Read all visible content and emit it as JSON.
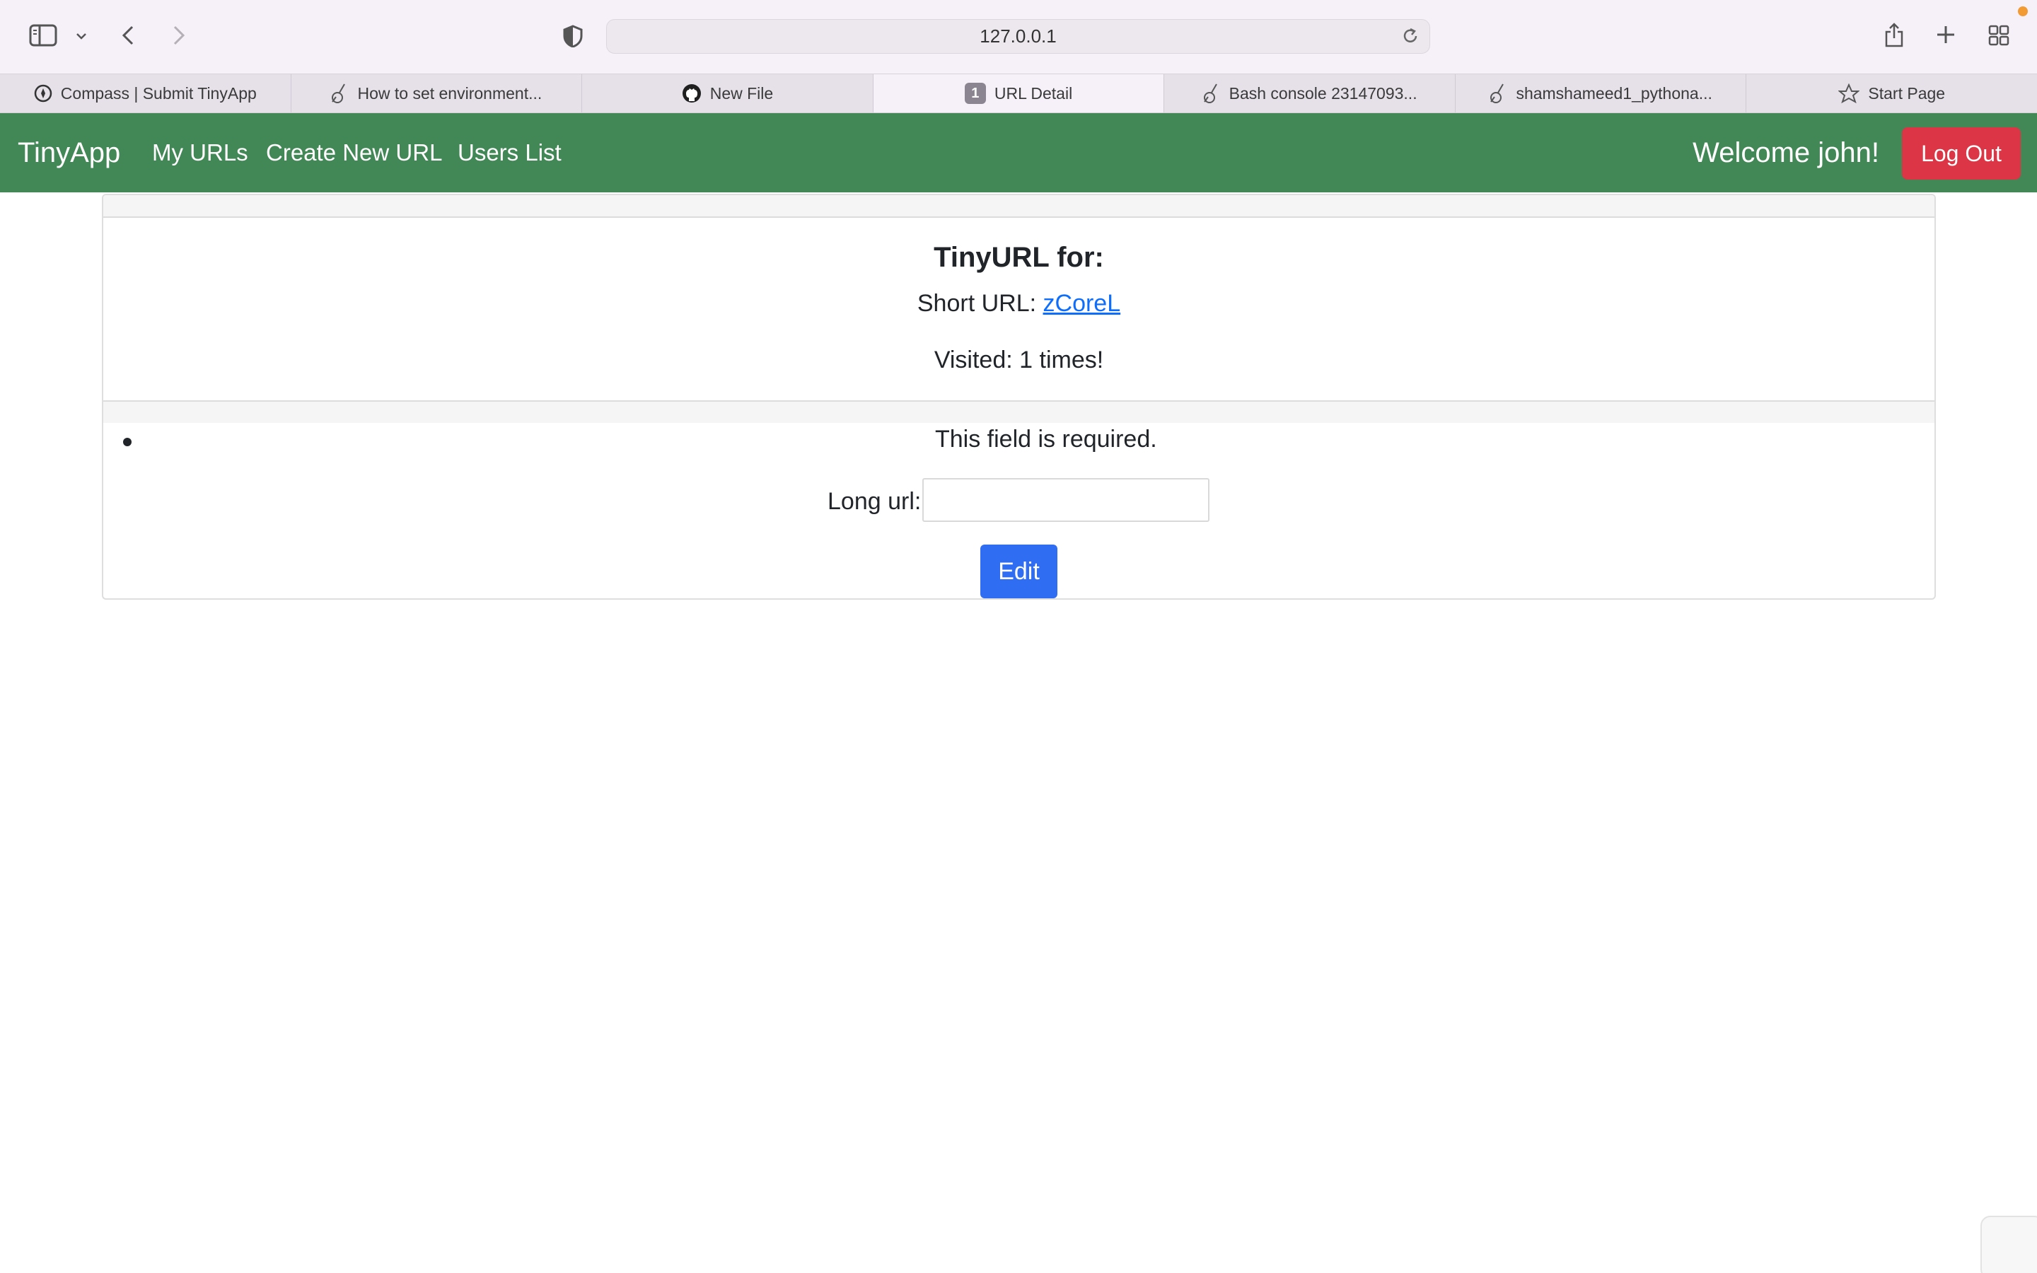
{
  "browser": {
    "address": "127.0.0.1",
    "tabs": [
      {
        "title": "Compass | Submit TinyApp",
        "icon": "compass-icon",
        "active": false
      },
      {
        "title": "How to set environment...",
        "icon": "guitar-icon",
        "active": false
      },
      {
        "title": "New File",
        "icon": "github-icon",
        "active": false
      },
      {
        "title": "URL Detail",
        "icon": "tab-number-badge",
        "badge": "1",
        "active": true
      },
      {
        "title": "Bash console 23147093...",
        "icon": "guitar-icon",
        "active": false
      },
      {
        "title": "shamshameed1_pythona...",
        "icon": "guitar-icon",
        "active": false
      },
      {
        "title": "Start Page",
        "icon": "star-icon",
        "active": false
      }
    ]
  },
  "navbar": {
    "brand": "TinyApp",
    "links": [
      "My URLs",
      "Create New URL",
      "Users List"
    ],
    "welcome": "Welcome john!",
    "logout": "Log Out",
    "color": "#428756"
  },
  "card": {
    "title": "TinyURL for:",
    "short_url_label": "Short URL:",
    "short_url": "zCoreL",
    "visited": "Visited: 1 times!",
    "error": "This field is required.",
    "long_url_label": "Long url:",
    "long_url_value": "",
    "edit_button": "Edit"
  },
  "colors": {
    "danger": "#dc3545",
    "primary": "#2f6ef2",
    "link": "#0d6efd"
  }
}
